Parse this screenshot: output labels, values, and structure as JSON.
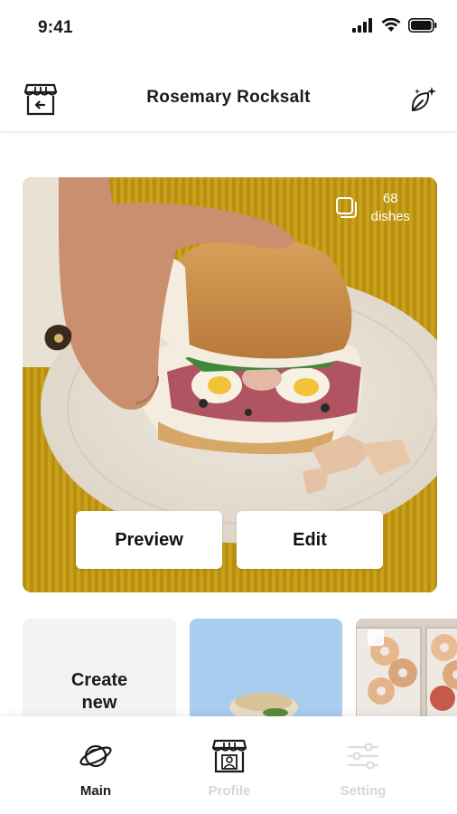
{
  "status_bar": {
    "time": "9:41"
  },
  "header": {
    "title": "Rosemary Rocksalt",
    "left_icon": "store-back-icon",
    "right_icon": "leaf-sparkle-icon"
  },
  "hero": {
    "dish_count": "68",
    "dish_label": "dishes",
    "preview_label": "Preview",
    "edit_label": "Edit"
  },
  "thumbnails": {
    "create_line1": "Create",
    "create_line2": "new"
  },
  "nav": {
    "items": [
      {
        "label": "Main",
        "icon": "planet-icon",
        "active": true
      },
      {
        "label": "Profile",
        "icon": "store-profile-icon",
        "active": false
      },
      {
        "label": "Setting",
        "icon": "sliders-icon",
        "active": false
      }
    ]
  },
  "colors": {
    "accent_yellow": "#c9a21a",
    "inactive_label": "#d6d6d6",
    "card_bg": "#f3f3f3"
  }
}
